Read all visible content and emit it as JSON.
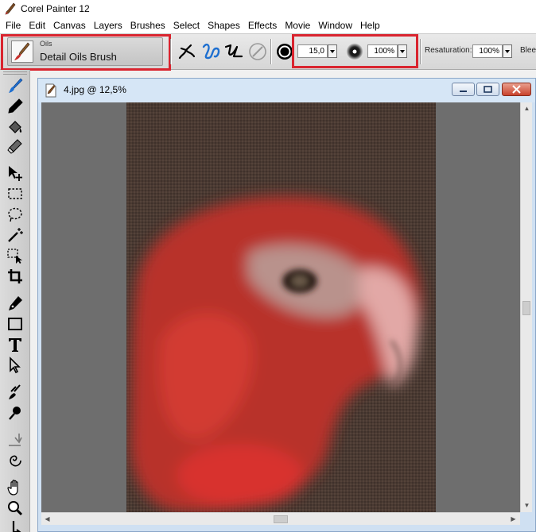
{
  "app": {
    "title": "Corel Painter 12"
  },
  "menu": [
    "File",
    "Edit",
    "Canvas",
    "Layers",
    "Brushes",
    "Select",
    "Shapes",
    "Effects",
    "Movie",
    "Window",
    "Help"
  ],
  "property_bar": {
    "brush_category": "Oils",
    "brush_name": "Detail Oils Brush",
    "size_value": "15,0",
    "opacity_value": "100%",
    "resaturation_label": "Resaturation:",
    "resaturation_value": "100%",
    "bleed_label": "Blee"
  },
  "document": {
    "title": "4.jpg @ 12,5%"
  },
  "colors": {
    "highlight": "#d9242f",
    "canvas_bg": "#6e6e6e",
    "painting_bg": "#4a3a32",
    "parrot_red": "#c8302d",
    "accent_blue": "#1e6fd0"
  },
  "icons": {
    "brush_preview": "oil-brush-icon",
    "brush_tool": "paint-brush-icon",
    "stroke_freehand": "freehand-stroke-icon",
    "stroke_straight": "straight-line-stroke-icon"
  }
}
